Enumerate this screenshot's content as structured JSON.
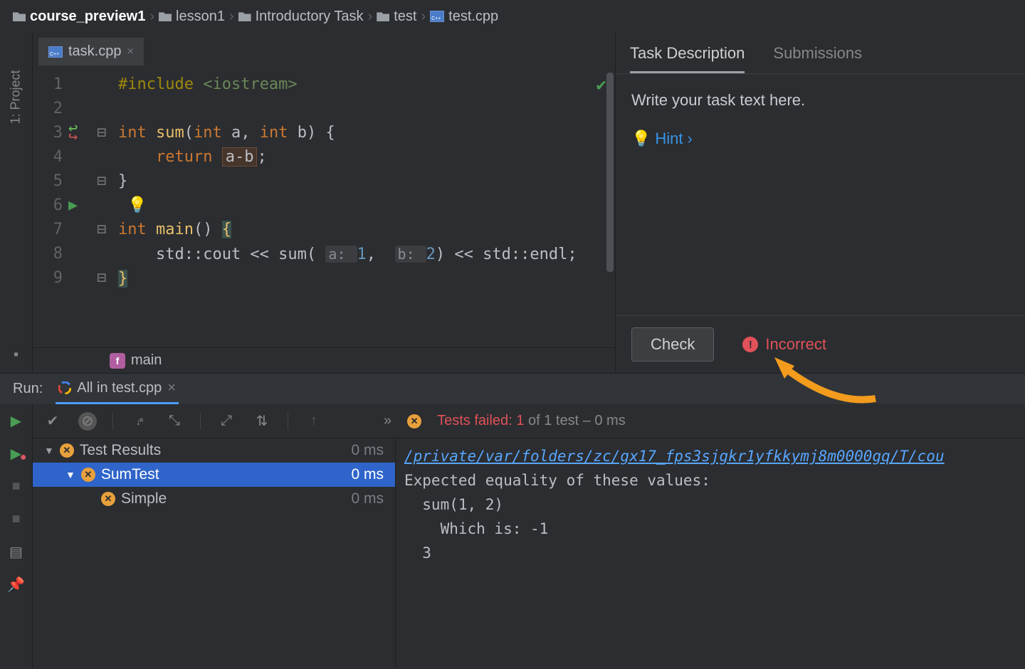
{
  "breadcrumbs": [
    {
      "label": "course_preview1",
      "active": true,
      "icon": "folder"
    },
    {
      "label": "lesson1",
      "active": false,
      "icon": "folder"
    },
    {
      "label": "Introductory Task",
      "active": false,
      "icon": "folder"
    },
    {
      "label": "test",
      "active": false,
      "icon": "folder"
    },
    {
      "label": "test.cpp",
      "active": false,
      "icon": "cpp"
    }
  ],
  "left_rail": {
    "project": "1: Project"
  },
  "editor": {
    "tab": {
      "filename": "task.cpp"
    },
    "lines": [
      "1",
      "2",
      "3",
      "4",
      "5",
      "6",
      "7",
      "8",
      "9"
    ],
    "code": {
      "l1_pp": "#include ",
      "l1_inc": "<iostream>",
      "l3_kw1": "int ",
      "l3_fn": "sum",
      "l3_sig1": "(",
      "l3_kw2": "int ",
      "l3_p1": "a",
      "l3_c": ", ",
      "l3_kw3": "int ",
      "l3_p2": "b",
      "l3_sig2": ") {",
      "l4_kw": "return ",
      "l4_expr": "a-b",
      "l4_semi": ";",
      "l5": "}",
      "l7_kw": "int ",
      "l7_fn": "main",
      "l7_sig": "() ",
      "l7_brace": "{",
      "l8_a": "std::cout << sum( ",
      "l8_h1": "a: ",
      "l8_n1": "1",
      "l8_c": ", ",
      "l8_h2": "b: ",
      "l8_n2": "2",
      "l8_b": ") << std::endl;",
      "l9": "}"
    },
    "crumb_fn": "main"
  },
  "task_panel": {
    "tabs": {
      "desc": "Task Description",
      "subs": "Submissions"
    },
    "body": "Write your task text here.",
    "hint_label": "Hint ",
    "check_btn": "Check",
    "status": "Incorrect"
  },
  "run": {
    "label": "Run:",
    "tab": "All in test.cpp",
    "summary_prefix": "Tests failed: ",
    "summary_fail": "1",
    "summary_suffix": " of 1 test – 0 ms",
    "tree": {
      "root": {
        "label": "Test Results",
        "time": "0 ms"
      },
      "suite": {
        "label": "SumTest",
        "time": "0 ms"
      },
      "case": {
        "label": "Simple",
        "time": "0 ms"
      }
    },
    "output": {
      "path": "/private/var/folders/zc/gx17_fps3sjgkr1yfkkymj8m0000gq/T/cou",
      "l2": "Expected equality of these values:",
      "l3": "  sum(1, 2)",
      "l4": "    Which is: -1",
      "l5": "  3"
    }
  }
}
